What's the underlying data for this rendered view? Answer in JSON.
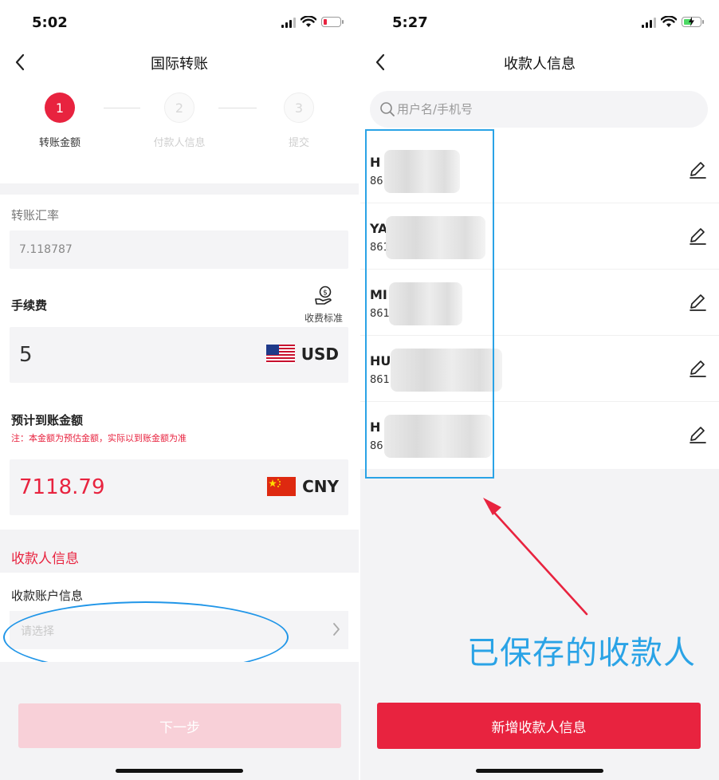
{
  "left_screen": {
    "status_time": "5:02",
    "nav_title": "国际转账",
    "steps": [
      {
        "number": "1",
        "label": "转账金额",
        "active": true
      },
      {
        "number": "2",
        "label": "付款人信息",
        "active": false
      },
      {
        "number": "3",
        "label": "提交",
        "active": false
      }
    ],
    "rate": {
      "label": "转账汇率",
      "value": "7.118787"
    },
    "fee": {
      "label": "手续费",
      "standard_label": "收费标准",
      "amount": "5",
      "currency": "USD"
    },
    "estimated": {
      "label": "预计到账金额",
      "note": "注：本金额为预估金额，实际以到账金额为准",
      "amount": "7118.79",
      "currency": "CNY"
    },
    "recipient_section_title": "收款人信息",
    "account": {
      "label": "收款账户信息",
      "placeholder": "请选择"
    },
    "next_button": "下一步"
  },
  "right_screen": {
    "status_time": "5:27",
    "nav_title": "收款人信息",
    "search_placeholder": "用户名/手机号",
    "contacts": [
      {
        "name": "H",
        "phone": "86"
      },
      {
        "name": "YA",
        "phone": "861"
      },
      {
        "name": "MI",
        "phone": "861"
      },
      {
        "name": "HU",
        "phone": "861"
      },
      {
        "name": "H",
        "phone": "86"
      }
    ],
    "annotation_caption": "已保存的收款人",
    "add_button": "新增收款人信息"
  },
  "colors": {
    "accent_red": "#e8233f",
    "disabled_pink": "#f8d0d8",
    "annotation_blue": "#2aa3e6",
    "arrow_red": "#e8233f"
  },
  "icons": {
    "back": "chevron-left-icon",
    "fee_standard": "money-hand-icon",
    "usd_flag": "us-flag-icon",
    "cny_flag": "cn-flag-icon",
    "select_chevron": "chevron-right-icon",
    "search": "search-icon",
    "edit": "pencil-icon"
  }
}
